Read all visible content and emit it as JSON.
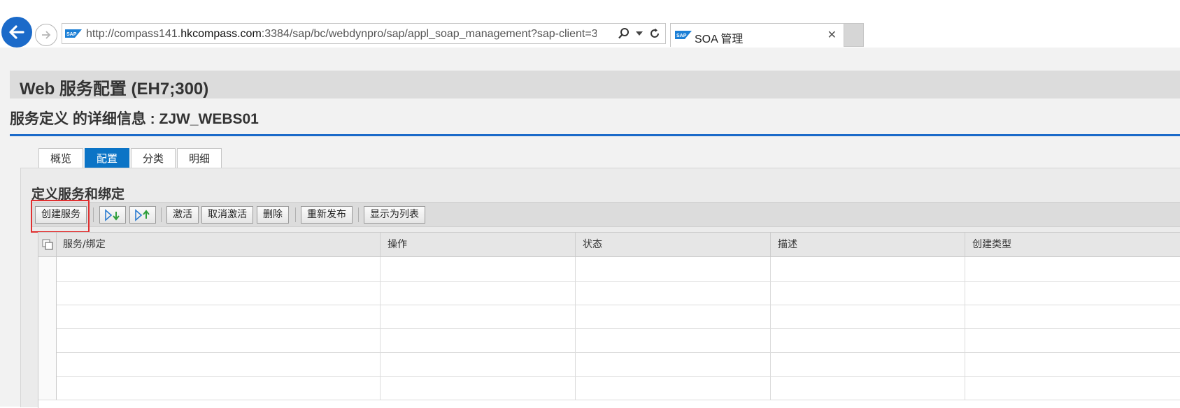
{
  "browser": {
    "url_prefix": "http://compass141.",
    "url_domain": "hkcompass.com",
    "url_rest": ":3384/sap/bc/webdynpro/sap/appl_soap_management?sap-client=3",
    "tab_title": "SOA 管理",
    "close_glyph": "✕"
  },
  "page": {
    "title": "Web 服务配置 (EH7;300)",
    "subtitle": "服务定义 的详细信息 : ZJW_WEBS01",
    "tabs": [
      "概览",
      "配置",
      "分类",
      "明细"
    ],
    "active_tab": "配置"
  },
  "panel": {
    "title": "定义服务和绑定",
    "toolbar": {
      "create_service": "创建服务",
      "activate": "激活",
      "deactivate": "取消激活",
      "delete": "删除",
      "republish": "重新发布",
      "show_as_list": "显示为列表"
    }
  },
  "table": {
    "columns": [
      "服务/绑定",
      "操作",
      "状态",
      "描述",
      "创建类型"
    ],
    "rows": [
      [],
      [],
      [],
      [],
      [],
      []
    ]
  },
  "colors": {
    "accent": "#1b6ac9",
    "active_tab": "#0b74c6",
    "highlight": "#e03030"
  }
}
